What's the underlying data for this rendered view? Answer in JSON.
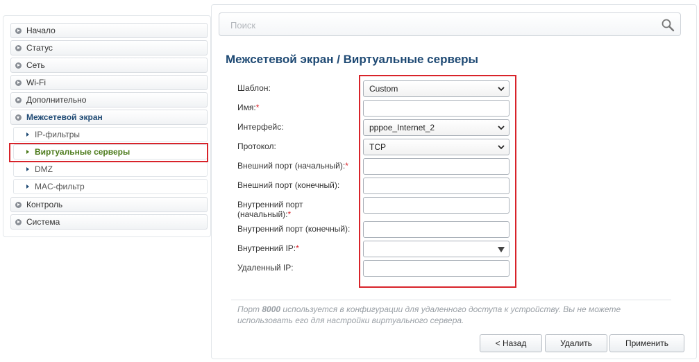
{
  "sidebar": {
    "items": [
      {
        "label": "Начало"
      },
      {
        "label": "Статус"
      },
      {
        "label": "Сеть"
      },
      {
        "label": "Wi-Fi"
      },
      {
        "label": "Дополнительно"
      },
      {
        "label": "Межсетевой экран"
      },
      {
        "label": "Контроль"
      },
      {
        "label": "Система"
      }
    ],
    "subitems": [
      {
        "label": "IP-фильтры"
      },
      {
        "label": "Виртуальные серверы"
      },
      {
        "label": "DMZ"
      },
      {
        "label": "MAC-фильтр"
      }
    ]
  },
  "search": {
    "placeholder": "Поиск"
  },
  "page": {
    "title": "Межсетевой экран /  Виртуальные серверы"
  },
  "form": {
    "template_label": "Шаблон:",
    "template_value": "Custom",
    "name_label": "Имя:",
    "name_value": "",
    "interface_label": "Интерфейс:",
    "interface_value": "pppoe_Internet_2",
    "protocol_label": "Протокол:",
    "protocol_value": "TCP",
    "ext_port_start_label": "Внешний порт (начальный):",
    "ext_port_start_value": "",
    "ext_port_end_label": "Внешний порт (конечный):",
    "ext_port_end_value": "",
    "int_port_start_label_line1": "Внутренний порт",
    "int_port_start_label_line2": "(начальный):",
    "int_port_start_value": "",
    "int_port_end_label": "Внутренний порт (конечный):",
    "int_port_end_value": "",
    "internal_ip_label": "Внутренний IP:",
    "internal_ip_value": "",
    "remote_ip_label": "Удаленный IP:",
    "remote_ip_value": "",
    "required_mark": "*"
  },
  "note": {
    "prefix": "Порт ",
    "port": "8000",
    "suffix": " используется в конфигурации для удаленного доступа к устройству. Вы не можете использовать его для настройки виртуального сервера."
  },
  "buttons": {
    "back": "< Назад",
    "delete": "Удалить",
    "apply": "Применить"
  }
}
